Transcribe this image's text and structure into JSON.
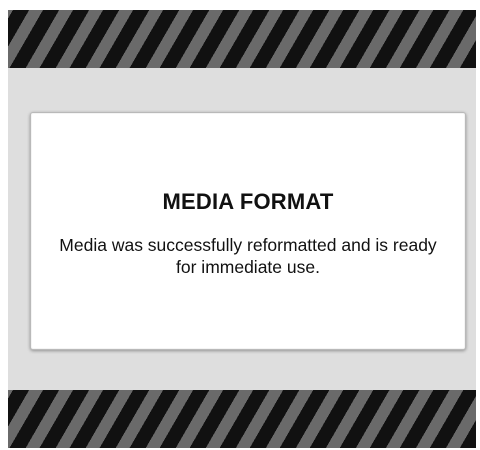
{
  "dialog": {
    "title": "MEDIA FORMAT",
    "message": "Media was successfully reformatted and is ready for immediate use."
  },
  "colors": {
    "background": "#dedede",
    "dialog_background": "#ffffff",
    "stripe_dark": "#111111",
    "stripe_light": "#6a6a6a",
    "text": "#111111"
  }
}
